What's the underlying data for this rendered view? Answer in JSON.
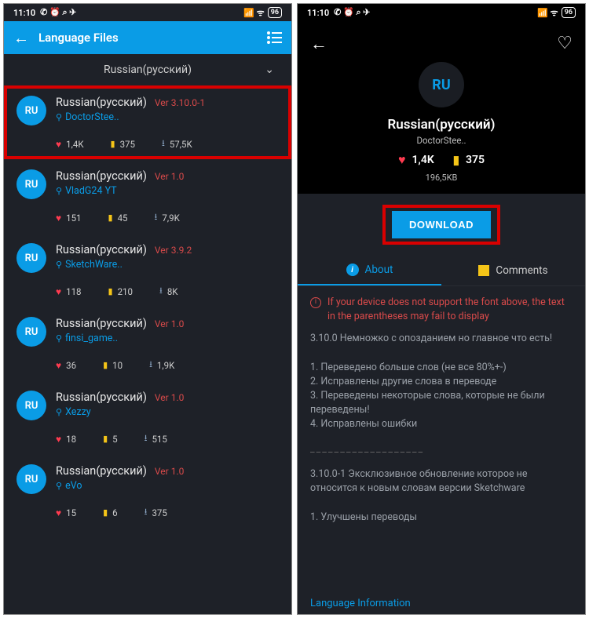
{
  "status": {
    "time": "11:10",
    "battery": "96"
  },
  "appbar": {
    "title": "Language Files"
  },
  "filter": {
    "label": "Russian(русский)"
  },
  "items": [
    {
      "avatar": "RU",
      "title": "Russian(русский)",
      "ver": "Ver 3.10.0-1",
      "author": "DoctorStee..",
      "likes": "1,4K",
      "comments": "375",
      "downloads": "57,5K"
    },
    {
      "avatar": "RU",
      "title": "Russian(русский)",
      "ver": "Ver 1.0",
      "author": "VladG24 YT",
      "likes": "151",
      "comments": "45",
      "downloads": "7,9K"
    },
    {
      "avatar": "RU",
      "title": "Russian(русский)",
      "ver": "Ver 3.9.2",
      "author": "SketchWare..",
      "likes": "118",
      "comments": "210",
      "downloads": "8K"
    },
    {
      "avatar": "RU",
      "title": "Russian(русский)",
      "ver": "Ver 1.0",
      "author": "finsi_game..",
      "likes": "36",
      "comments": "10",
      "downloads": "1,9K"
    },
    {
      "avatar": "RU",
      "title": "Russian(русский)",
      "ver": "Ver 1.0",
      "author": "Xezzy",
      "likes": "18",
      "comments": "5",
      "downloads": "515"
    },
    {
      "avatar": "RU",
      "title": "Russian(русский)",
      "ver": "Ver 1.0",
      "author": "eVo",
      "likes": "15",
      "comments": "6",
      "downloads": "375"
    }
  ],
  "detail": {
    "avatar": "RU",
    "title": "Russian(русский)",
    "author": "DoctorStee..",
    "likes": "1,4K",
    "comments": "375",
    "size": "196,5KB",
    "download": "DOWNLOAD",
    "tabs": {
      "about": "About",
      "comments": "Comments"
    },
    "warn": "If your device does not support the font above, the text in the parentheses may fail to display",
    "body1": "3.10.0 Немножко с опозданием но главное что есть!",
    "body2": "1. Переведено больше слов (не все 80%+-)",
    "body3": "2. Исправлены другие слова в переводе",
    "body4": "3. Переведены некоторые слова, которые не были переведены!",
    "body5": "4. Исправлены ошибки",
    "sep": "___________________",
    "body6": "3.10.0-1 Эксклюзивное обновление которое не относится к новым словам версии Sketchware",
    "body7": "1. Улучшены переводы",
    "footer": "Language Information"
  }
}
